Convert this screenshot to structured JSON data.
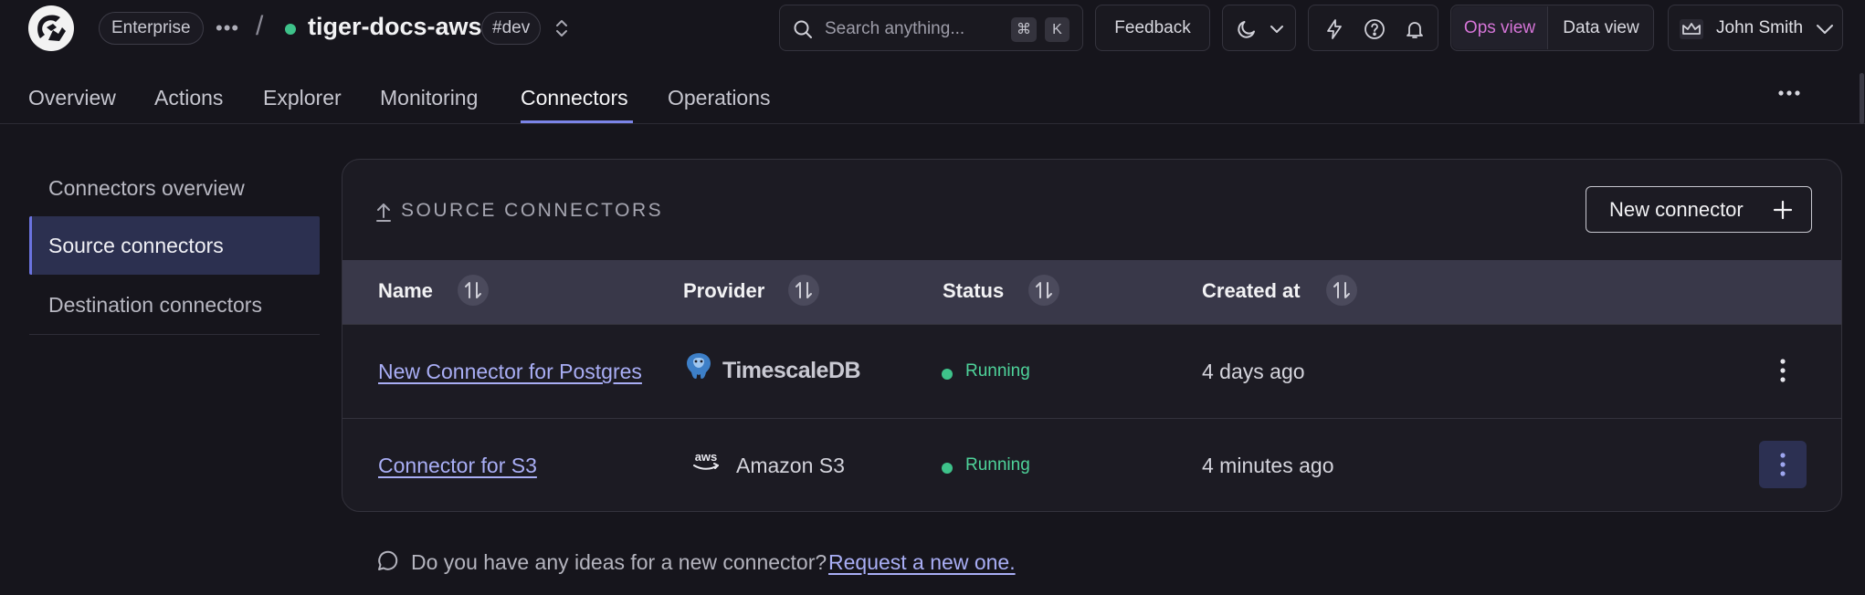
{
  "header": {
    "plan_badge": "Enterprise",
    "more_icon": "more-horizontal-icon",
    "separator": "/",
    "service_name": "tiger-docs-aws",
    "service_status_color": "#3ec28a",
    "env_tag": "#dev",
    "search_placeholder": "Search anything...",
    "search_shortcut_1": "⌘",
    "search_shortcut_2": "K",
    "feedback_label": "Feedback",
    "ops_view_label": "Ops view",
    "data_view_label": "Data view",
    "user_name": "John Smith"
  },
  "tabs": [
    {
      "label": "Overview"
    },
    {
      "label": "Actions"
    },
    {
      "label": "Explorer"
    },
    {
      "label": "Monitoring"
    },
    {
      "label": "Connectors",
      "active": true
    },
    {
      "label": "Operations"
    }
  ],
  "sidebar": {
    "items": [
      {
        "label": "Connectors overview"
      },
      {
        "label": "Source connectors",
        "active": true
      },
      {
        "label": "Destination connectors"
      }
    ]
  },
  "card": {
    "title": "SOURCE CONNECTORS",
    "new_button": "New connector",
    "columns": [
      "Name",
      "Provider",
      "Status",
      "Created at"
    ],
    "rows": [
      {
        "name": "New Connector for Postgres",
        "provider": "TimescaleDB",
        "provider_icon": "timescaledb-logo-icon",
        "status": "Running",
        "created": "4 days ago"
      },
      {
        "name": "Connector for S3",
        "provider": "Amazon S3",
        "provider_icon": "aws-logo-icon",
        "status": "Running",
        "created": "4 minutes ago"
      }
    ]
  },
  "footer": {
    "prompt": "Do you have any ideas for a new connector?",
    "link": "Request a new one."
  },
  "colors": {
    "accent": "#7b84e8",
    "status_running": "#4ed39a",
    "ops_view": "#d675d8",
    "link": "#a9aef5"
  }
}
